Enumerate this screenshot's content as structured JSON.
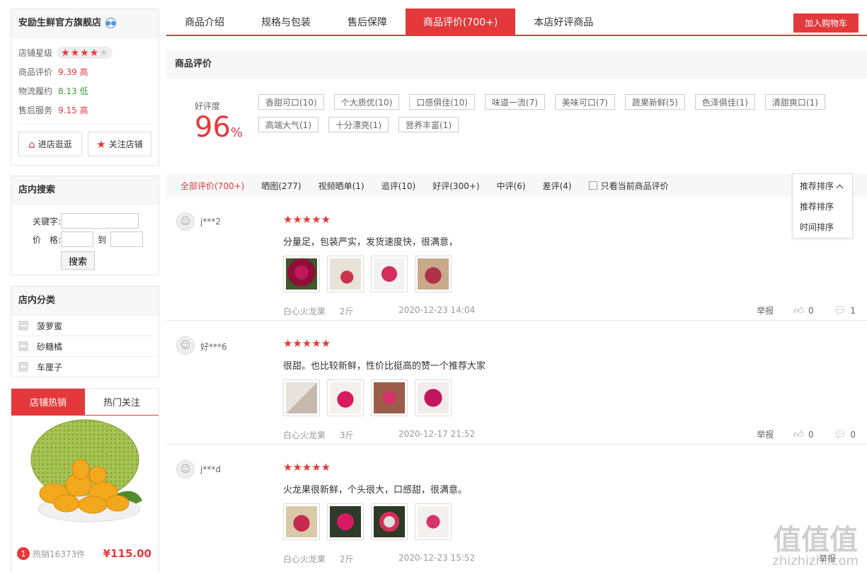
{
  "store": {
    "name": "安励生鲜官方旗舰店",
    "rating_label": "店铺星级",
    "stars_on": 4,
    "metrics": [
      {
        "label": "商品评价",
        "value": "9.39 高",
        "color": "#e4393c"
      },
      {
        "label": "物流履约",
        "value": "8.13 低",
        "color": "#3d9c3d"
      },
      {
        "label": "售后服务",
        "value": "9.15 高",
        "color": "#e4393c"
      }
    ],
    "enter_label": "进店逛逛",
    "follow_label": "关注店铺"
  },
  "search": {
    "title": "店内搜索",
    "keyword_label": "关键字:",
    "price_label": "价　格:",
    "to_label": "到",
    "button": "搜索"
  },
  "categories": {
    "title": "店内分类",
    "items": [
      "菠萝蜜",
      "砂糖橘",
      "车厘子"
    ]
  },
  "hot": {
    "tabs": [
      "店铺热销",
      "热门关注"
    ],
    "rank": "1",
    "sold": "热销16373件",
    "price": "¥115.00"
  },
  "tabs": [
    "商品介绍",
    "规格与包装",
    "售后保障",
    "商品评价(700+)",
    "本店好评商品"
  ],
  "cart_button": "加入购物车",
  "reviews_section": {
    "title": "商品评价",
    "good_label": "好评度",
    "good_value": "96",
    "good_pct": "%",
    "tags": [
      "香甜可口(10)",
      "个大质优(10)",
      "口感俱佳(10)",
      "味道一流(7)",
      "美味可口(7)",
      "蔬果新鲜(5)",
      "色泽俱佳(1)",
      "清甜爽口(1)",
      "高端大气(1)",
      "十分漂亮(1)",
      "营养丰富(1)"
    ]
  },
  "filters": [
    "全部评价(700+)",
    "晒图(277)",
    "视频晒单(1)",
    "追评(10)",
    "好评(300+)",
    "中评(6)",
    "差评(4)"
  ],
  "only_current": "只看当前商品评价",
  "sort": {
    "current": "推荐排序",
    "options": [
      "推荐排序",
      "时间排序"
    ]
  },
  "reviews": [
    {
      "user": "j***2",
      "text": "分量足，包装严实，发货速度快，很满意，",
      "variant": "白心火龙果",
      "weight": "2斤",
      "date": "2020-12-23 14:04",
      "likes": "0",
      "comments": "1"
    },
    {
      "user": "好***6",
      "text": "很甜。也比较新鲜，性价比挺高的赞一个推荐大家",
      "variant": "白心火龙果",
      "weight": "3斤",
      "date": "2020-12-17 21:52",
      "likes": "0",
      "comments": "0"
    },
    {
      "user": "j***d",
      "text": "火龙果很新鲜，个头很大，口感甜，很满意。",
      "variant": "白心火龙果",
      "weight": "2斤",
      "date": "2020-12-23 15:52",
      "likes": "0",
      "comments": "0"
    }
  ],
  "report_label": "举报",
  "watermark": {
    "main": "值值值",
    "url": "zhizhizhi.com"
  },
  "colors": {
    "accent": "#e4393c",
    "good": "#3d9c3d"
  }
}
